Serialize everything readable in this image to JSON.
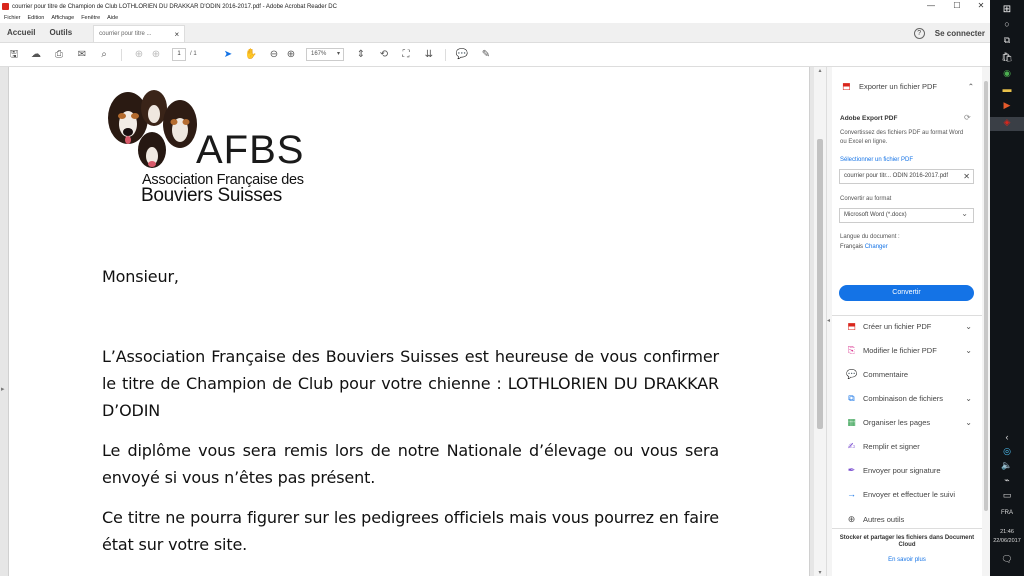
{
  "window": {
    "title": "courrier pour titre de Champion de Club LOTHLORIEN DU DRAKKAR D'ODIN 2016-2017.pdf - Adobe Acrobat Reader DC",
    "controls": [
      "—",
      "☐",
      "✕"
    ]
  },
  "menu": [
    "Fichier",
    "Edition",
    "Affichage",
    "Fenêtre",
    "Aide"
  ],
  "tabs": {
    "home": "Accueil",
    "tools": "Outils",
    "document": "courrier pour titre ...",
    "close": "×",
    "help": "?",
    "signin": "Se connecter"
  },
  "toolbar": {
    "page_current": "1",
    "page_total": "/ 1",
    "zoom": "167%"
  },
  "logo": {
    "acronym": "AFBS",
    "line1": "Association Française des",
    "line2": "Bouviers Suisses"
  },
  "letter": {
    "salutation": "Monsieur,",
    "paragraph1": "L’Association Française des Bouviers Suisses est heureuse de vous confirmer le titre de Champion de Club pour votre chienne : LOTHLORIEN DU DRAKKAR D’ODIN",
    "paragraph2": "Le diplôme vous sera remis lors de notre Nationale d’élevage ou vous sera envoyé si vous n’êtes pas présent.",
    "paragraph3": "Ce titre ne pourra figurer sur les pedigrees officiels mais vous pourrez en faire état sur votre  site."
  },
  "panel": {
    "export_header": "Exporter un fichier PDF",
    "service_title": "Adobe Export PDF",
    "description": "Convertissez des fichiers PDF au format Word ou Excel en ligne.",
    "select_file": "Sélectionner un fichier PDF",
    "file_name": "courrier pour titr... ODIN 2016-2017.pdf",
    "convert_to_label": "Convertir au format",
    "format": "Microsoft Word (*.docx)",
    "doc_language_label": "Langue du document :",
    "doc_language": "Français",
    "change": "Changer",
    "convert_button": "Convertir",
    "tools": [
      {
        "label": "Créer un fichier PDF",
        "chevron": true
      },
      {
        "label": "Modifier le fichier PDF",
        "chevron": true
      },
      {
        "label": "Commentaire",
        "chevron": false
      },
      {
        "label": "Combinaison de fichiers",
        "chevron": true
      },
      {
        "label": "Organiser les pages",
        "chevron": true
      },
      {
        "label": "Remplir et signer",
        "chevron": false
      },
      {
        "label": "Envoyer pour signature",
        "chevron": false
      },
      {
        "label": "Envoyer et effectuer le suivi",
        "chevron": false
      },
      {
        "label": "Autres outils",
        "chevron": false
      }
    ],
    "cloud_text": "Stocker et partager les fichiers dans Document Cloud",
    "cloud_link": "En savoir plus"
  },
  "taskbar": {
    "language": "FRA",
    "time": "21:46",
    "date": "22/06/2017"
  },
  "colors": {
    "accent": "#1473e6",
    "pdf_red": "#d9261c",
    "taskbar": "#101418"
  }
}
